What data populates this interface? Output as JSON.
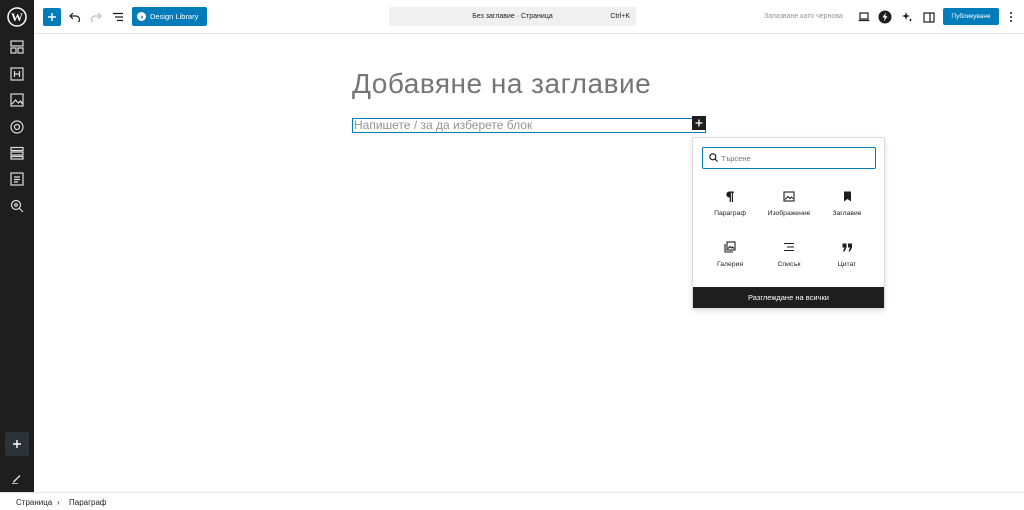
{
  "toolbar": {
    "design_library_label": "Design Library",
    "document_title": "Без заглавие · Страница",
    "shortcut": "Ctrl+K",
    "save_draft_label": "Запазване като чернова",
    "publish_label": "Публикуване"
  },
  "canvas": {
    "title_placeholder": "Добавяне на заглавие",
    "block_placeholder": "Напишете / за да изберете блок"
  },
  "inserter": {
    "search_placeholder": "Търсене",
    "blocks": [
      {
        "label": "Параграф",
        "icon": "paragraph-icon"
      },
      {
        "label": "Изображение",
        "icon": "image-icon"
      },
      {
        "label": "Заглавие",
        "icon": "heading-icon"
      },
      {
        "label": "Галерия",
        "icon": "gallery-icon"
      },
      {
        "label": "Списък",
        "icon": "list-icon"
      },
      {
        "label": "Цитат",
        "icon": "quote-icon"
      }
    ],
    "browse_all_label": "Разглеждане на всички"
  },
  "breadcrumb": {
    "items": [
      "Страница",
      "Параграф"
    ]
  },
  "colors": {
    "accent": "#007cba",
    "sidebar_bg": "#1e1e1e",
    "text_muted": "#757575"
  }
}
